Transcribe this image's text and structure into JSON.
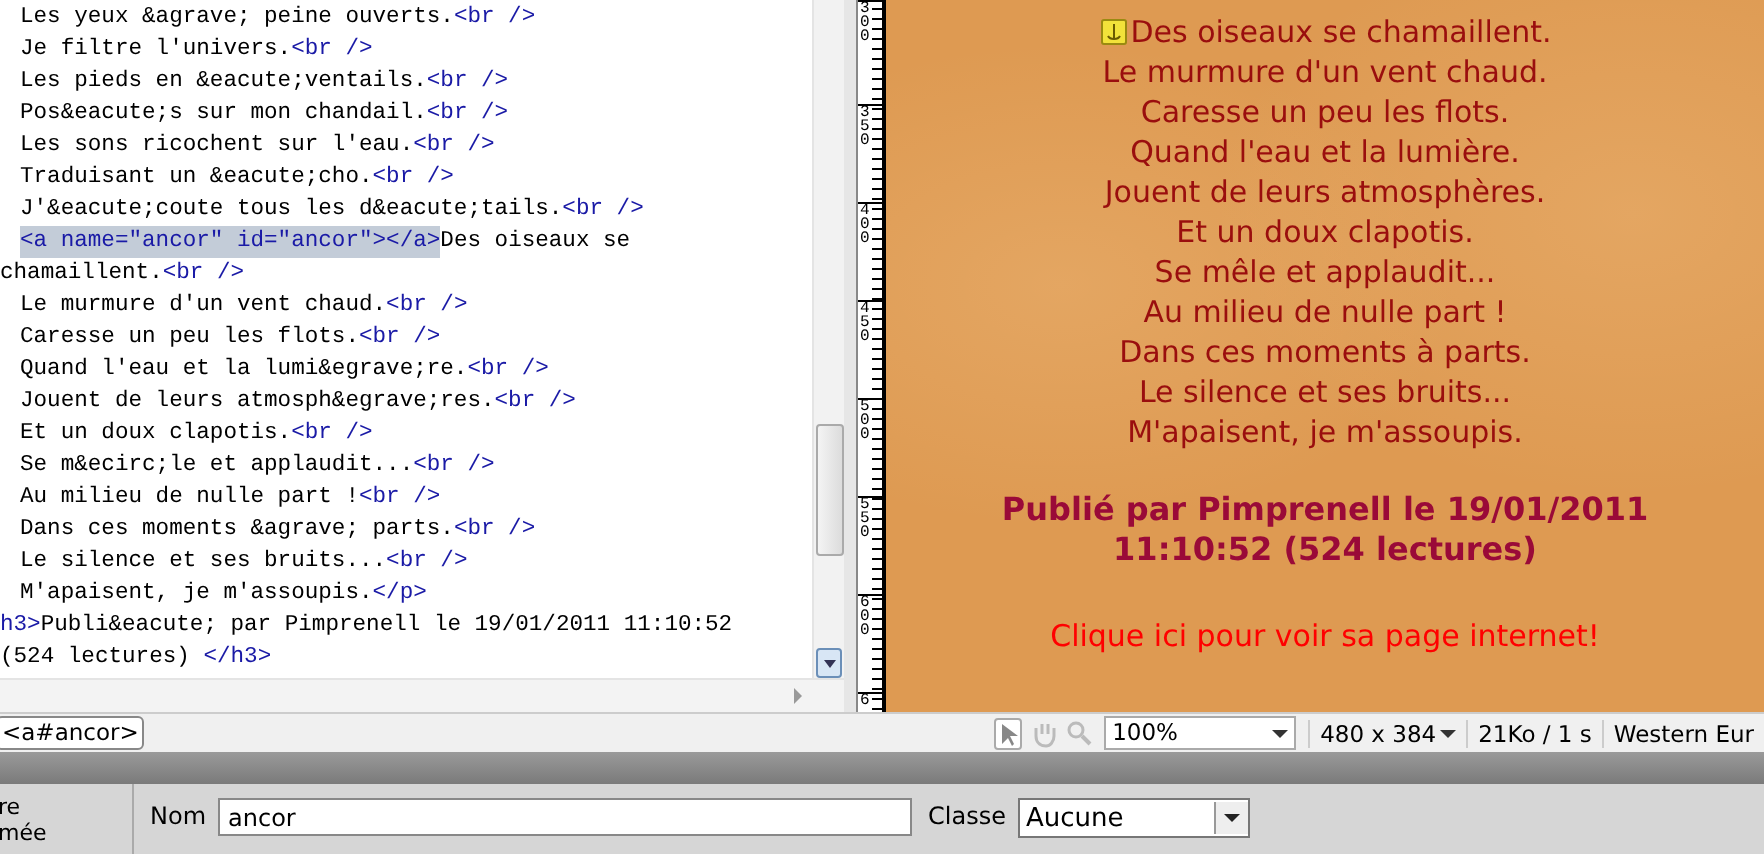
{
  "code_editor": {
    "lines": [
      {
        "indented": true,
        "segments": [
          {
            "kind": "text",
            "text": "Les yeux &agrave; peine ouverts."
          },
          {
            "kind": "tag",
            "text": "<br />"
          }
        ]
      },
      {
        "indented": true,
        "segments": [
          {
            "kind": "text",
            "text": "Je filtre l'univers."
          },
          {
            "kind": "tag",
            "text": "<br />"
          }
        ]
      },
      {
        "indented": true,
        "segments": [
          {
            "kind": "text",
            "text": "Les pieds en &eacute;ventails."
          },
          {
            "kind": "tag",
            "text": "<br />"
          }
        ]
      },
      {
        "indented": true,
        "segments": [
          {
            "kind": "text",
            "text": "Pos&eacute;s sur mon chandail."
          },
          {
            "kind": "tag",
            "text": "<br />"
          }
        ]
      },
      {
        "indented": true,
        "segments": [
          {
            "kind": "text",
            "text": "Les sons ricochent sur l'eau."
          },
          {
            "kind": "tag",
            "text": "<br />"
          }
        ]
      },
      {
        "indented": true,
        "segments": [
          {
            "kind": "text",
            "text": "Traduisant un &eacute;cho."
          },
          {
            "kind": "tag",
            "text": "<br />"
          }
        ]
      },
      {
        "indented": true,
        "segments": [
          {
            "kind": "text",
            "text": "J'&eacute;coute tous les d&eacute;tails."
          },
          {
            "kind": "tag",
            "text": "<br />"
          }
        ]
      },
      {
        "indented": true,
        "segments": [
          {
            "kind": "selection",
            "text": "<a name=\"ancor\" id=\"ancor\"></a>"
          },
          {
            "kind": "text",
            "text": "Des oiseaux se"
          }
        ]
      },
      {
        "indented": false,
        "segments": [
          {
            "kind": "text",
            "text": "chamaillent."
          },
          {
            "kind": "tag",
            "text": "<br />"
          }
        ]
      },
      {
        "indented": true,
        "segments": [
          {
            "kind": "text",
            "text": "Le murmure d'un vent chaud."
          },
          {
            "kind": "tag",
            "text": "<br />"
          }
        ]
      },
      {
        "indented": true,
        "segments": [
          {
            "kind": "text",
            "text": "Caresse un peu les flots."
          },
          {
            "kind": "tag",
            "text": "<br />"
          }
        ]
      },
      {
        "indented": true,
        "segments": [
          {
            "kind": "text",
            "text": "Quand l'eau et la lumi&egrave;re."
          },
          {
            "kind": "tag",
            "text": "<br />"
          }
        ]
      },
      {
        "indented": true,
        "segments": [
          {
            "kind": "text",
            "text": "Jouent de leurs atmosph&egrave;res."
          },
          {
            "kind": "tag",
            "text": "<br />"
          }
        ]
      },
      {
        "indented": true,
        "segments": [
          {
            "kind": "text",
            "text": "Et un doux clapotis."
          },
          {
            "kind": "tag",
            "text": "<br />"
          }
        ]
      },
      {
        "indented": true,
        "segments": [
          {
            "kind": "text",
            "text": "Se m&ecirc;le et applaudit..."
          },
          {
            "kind": "tag",
            "text": "<br />"
          }
        ]
      },
      {
        "indented": true,
        "segments": [
          {
            "kind": "text",
            "text": "Au milieu de nulle part !"
          },
          {
            "kind": "tag",
            "text": "<br />"
          }
        ]
      },
      {
        "indented": true,
        "segments": [
          {
            "kind": "text",
            "text": "Dans ces moments &agrave; parts."
          },
          {
            "kind": "tag",
            "text": "<br />"
          }
        ]
      },
      {
        "indented": true,
        "segments": [
          {
            "kind": "text",
            "text": "Le silence et ses bruits..."
          },
          {
            "kind": "tag",
            "text": "<br />"
          }
        ]
      },
      {
        "indented": true,
        "segments": [
          {
            "kind": "text",
            "text": "M'apaisent, je m'assoupis."
          },
          {
            "kind": "tag",
            "text": "</p>"
          }
        ]
      },
      {
        "indented": false,
        "segments": [
          {
            "kind": "tag",
            "text": "h3>"
          },
          {
            "kind": "text",
            "text": "Publi&eacute; par Pimprenell le 19/01/2011 11:10:52"
          }
        ]
      },
      {
        "indented": false,
        "segments": [
          {
            "kind": "text",
            "text": "(524 lectures) "
          },
          {
            "kind": "tag",
            "text": "</h3>"
          }
        ]
      }
    ]
  },
  "ruler": {
    "labels": [
      "300",
      "350",
      "400",
      "450",
      "500",
      "550",
      "600",
      "6"
    ]
  },
  "design_view": {
    "poem_lines": [
      {
        "text": "Des oiseaux se chamaillent.",
        "anchor": true
      },
      {
        "text": "Le murmure d'un vent chaud.",
        "anchor": false
      },
      {
        "text": "Caresse un peu les flots.",
        "anchor": false
      },
      {
        "text": "Quand l'eau et la lumière.",
        "anchor": false
      },
      {
        "text": "Jouent de leurs atmosphères.",
        "anchor": false
      },
      {
        "text": "Et un doux clapotis.",
        "anchor": false
      },
      {
        "text": "Se mêle et applaudit...",
        "anchor": false
      },
      {
        "text": "Au milieu de nulle part !",
        "anchor": false
      },
      {
        "text": "Dans ces moments à parts.",
        "anchor": false
      },
      {
        "text": "Le silence et ses bruits...",
        "anchor": false
      },
      {
        "text": "M'apaisent, je m'assoupis.",
        "anchor": false
      }
    ],
    "heading": "Publié par Pimprenell le 19/01/2011 11:10:52 (524 lectures)",
    "link": "Clique ici pour voir sa page internet!"
  },
  "status_bar": {
    "tag": "<a#ancor>",
    "zoom": "100%",
    "size": "480 x 384",
    "download": "21Ko / 1 s",
    "encoding": "Western Eur"
  },
  "properties": {
    "type_label": [
      "re",
      "mée"
    ],
    "name_label": "Nom",
    "name_value": "ancor",
    "class_label": "Classe",
    "class_value": "Aucune"
  }
}
